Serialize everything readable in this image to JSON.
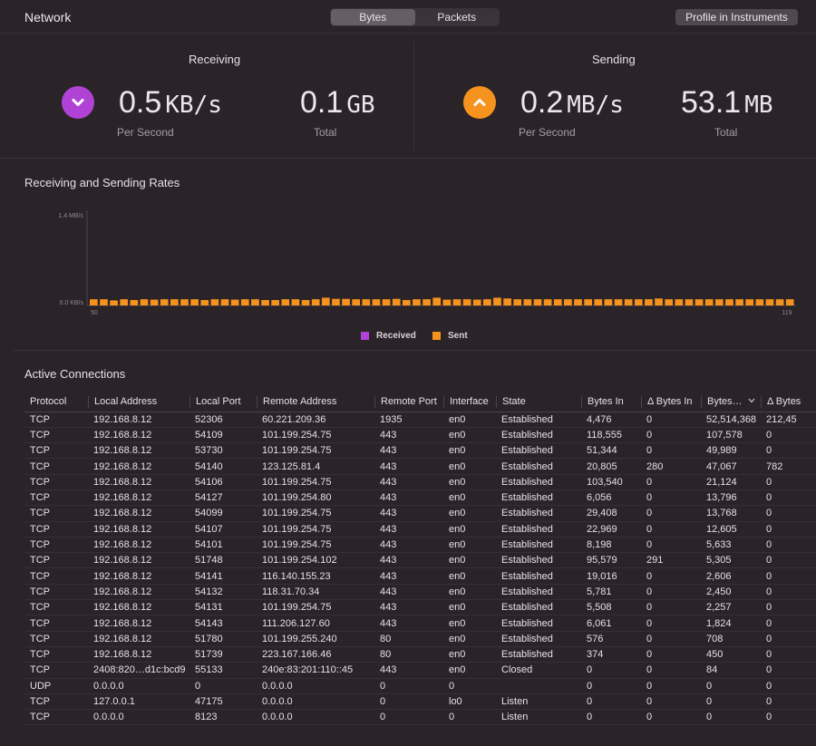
{
  "header": {
    "title": "Network",
    "segments": [
      "Bytes",
      "Packets"
    ],
    "active_segment": "Bytes",
    "profile_button": "Profile in Instruments"
  },
  "receiving": {
    "title": "Receiving",
    "rate_value": "0.5",
    "rate_unit": "KB/s",
    "rate_label": "Per Second",
    "total_value": "0.1",
    "total_unit": "GB",
    "total_label": "Total",
    "icon": "chevron-down-icon",
    "color": "#b043d6"
  },
  "sending": {
    "title": "Sending",
    "rate_value": "0.2",
    "rate_unit": "MB/s",
    "rate_label": "Per Second",
    "total_value": "53.1",
    "total_unit": "MB",
    "total_label": "Total",
    "icon": "chevron-up-icon",
    "color": "#f6921e"
  },
  "rates_section": {
    "title": "Receiving and Sending Rates"
  },
  "chart_data": {
    "type": "bar",
    "title": "Receiving and Sending Rates",
    "ytick_labels": [
      "1.4 MB/s",
      "0.0 KB/s"
    ],
    "xtick_labels": [
      "50",
      "119"
    ],
    "x_start": 50,
    "x_end": 119,
    "ylim": [
      0,
      1.4
    ],
    "legend": [
      "Received",
      "Sent"
    ],
    "legend_placement": "bottom-center",
    "series": [
      {
        "name": "Received",
        "color": "#b043d6",
        "values": [
          0,
          0,
          0,
          0,
          0,
          0,
          0,
          0,
          0,
          0,
          0,
          0,
          0,
          0,
          0,
          0,
          0,
          0,
          0,
          0,
          0,
          0,
          0,
          0,
          0,
          0,
          0,
          0,
          0,
          0,
          0,
          0,
          0,
          0,
          0,
          0,
          0,
          0,
          0,
          0,
          0,
          0,
          0,
          0,
          0,
          0,
          0,
          0,
          0,
          0,
          0,
          0,
          0,
          0,
          0,
          0,
          0,
          0,
          0,
          0,
          0,
          0,
          0,
          0,
          0,
          0,
          0,
          0,
          0,
          0
        ]
      },
      {
        "name": "Sent",
        "color": "#f6921e",
        "values": [
          0.16,
          0.16,
          0.13,
          0.16,
          0.14,
          0.16,
          0.15,
          0.16,
          0.16,
          0.16,
          0.16,
          0.14,
          0.16,
          0.16,
          0.15,
          0.16,
          0.16,
          0.14,
          0.14,
          0.16,
          0.16,
          0.14,
          0.16,
          0.2,
          0.17,
          0.17,
          0.16,
          0.16,
          0.16,
          0.16,
          0.17,
          0.14,
          0.16,
          0.16,
          0.2,
          0.15,
          0.16,
          0.16,
          0.15,
          0.16,
          0.2,
          0.18,
          0.16,
          0.16,
          0.16,
          0.16,
          0.16,
          0.16,
          0.16,
          0.16,
          0.16,
          0.16,
          0.16,
          0.16,
          0.16,
          0.16,
          0.18,
          0.16,
          0.16,
          0.16,
          0.16,
          0.16,
          0.16,
          0.16,
          0.16,
          0.16,
          0.16,
          0.16,
          0.16,
          0.16
        ]
      }
    ]
  },
  "connections": {
    "title": "Active Connections",
    "columns": [
      "Protocol",
      "Local Address",
      "Local Port",
      "Remote Address",
      "Remote Port",
      "Interface",
      "State",
      "Bytes In",
      "Δ Bytes In",
      "Bytes…",
      "Δ Bytes"
    ],
    "rows": [
      [
        "TCP",
        "192.168.8.12",
        "52306",
        "60.221.209.36",
        "1935",
        "en0",
        "Established",
        "4,476",
        "0",
        "52,514,368",
        "212,45"
      ],
      [
        "TCP",
        "192.168.8.12",
        "54109",
        "101.199.254.75",
        "443",
        "en0",
        "Established",
        "118,555",
        "0",
        "107,578",
        "0"
      ],
      [
        "TCP",
        "192.168.8.12",
        "53730",
        "101.199.254.75",
        "443",
        "en0",
        "Established",
        "51,344",
        "0",
        "49,989",
        "0"
      ],
      [
        "TCP",
        "192.168.8.12",
        "54140",
        "123.125.81.4",
        "443",
        "en0",
        "Established",
        "20,805",
        "280",
        "47,067",
        "782"
      ],
      [
        "TCP",
        "192.168.8.12",
        "54106",
        "101.199.254.75",
        "443",
        "en0",
        "Established",
        "103,540",
        "0",
        "21,124",
        "0"
      ],
      [
        "TCP",
        "192.168.8.12",
        "54127",
        "101.199.254.80",
        "443",
        "en0",
        "Established",
        "6,056",
        "0",
        "13,796",
        "0"
      ],
      [
        "TCP",
        "192.168.8.12",
        "54099",
        "101.199.254.75",
        "443",
        "en0",
        "Established",
        "29,408",
        "0",
        "13,768",
        "0"
      ],
      [
        "TCP",
        "192.168.8.12",
        "54107",
        "101.199.254.75",
        "443",
        "en0",
        "Established",
        "22,969",
        "0",
        "12,605",
        "0"
      ],
      [
        "TCP",
        "192.168.8.12",
        "54101",
        "101.199.254.75",
        "443",
        "en0",
        "Established",
        "8,198",
        "0",
        "5,633",
        "0"
      ],
      [
        "TCP",
        "192.168.8.12",
        "51748",
        "101.199.254.102",
        "443",
        "en0",
        "Established",
        "95,579",
        "291",
        "5,305",
        "0"
      ],
      [
        "TCP",
        "192.168.8.12",
        "54141",
        "116.140.155.23",
        "443",
        "en0",
        "Established",
        "19,016",
        "0",
        "2,606",
        "0"
      ],
      [
        "TCP",
        "192.168.8.12",
        "54132",
        "118.31.70.34",
        "443",
        "en0",
        "Established",
        "5,781",
        "0",
        "2,450",
        "0"
      ],
      [
        "TCP",
        "192.168.8.12",
        "54131",
        "101.199.254.75",
        "443",
        "en0",
        "Established",
        "5,508",
        "0",
        "2,257",
        "0"
      ],
      [
        "TCP",
        "192.168.8.12",
        "54143",
        "111.206.127.60",
        "443",
        "en0",
        "Established",
        "6,061",
        "0",
        "1,824",
        "0"
      ],
      [
        "TCP",
        "192.168.8.12",
        "51780",
        "101.199.255.240",
        "80",
        "en0",
        "Established",
        "576",
        "0",
        "708",
        "0"
      ],
      [
        "TCP",
        "192.168.8.12",
        "51739",
        "223.167.166.46",
        "80",
        "en0",
        "Established",
        "374",
        "0",
        "450",
        "0"
      ],
      [
        "TCP",
        "2408:820…d1c:bcd9",
        "55133",
        "240e:83:201:110::45",
        "443",
        "en0",
        "Closed",
        "0",
        "0",
        "84",
        "0"
      ],
      [
        "UDP",
        "0.0.0.0",
        "0",
        "0.0.0.0",
        "0",
        "0",
        "",
        "0",
        "0",
        "0",
        "0"
      ],
      [
        "TCP",
        "127.0.0.1",
        "47175",
        "0.0.0.0",
        "0",
        "lo0",
        "Listen",
        "0",
        "0",
        "0",
        "0"
      ],
      [
        "TCP",
        "0.0.0.0",
        "8123",
        "0.0.0.0",
        "0",
        "0",
        "Listen",
        "0",
        "0",
        "0",
        "0"
      ]
    ]
  }
}
